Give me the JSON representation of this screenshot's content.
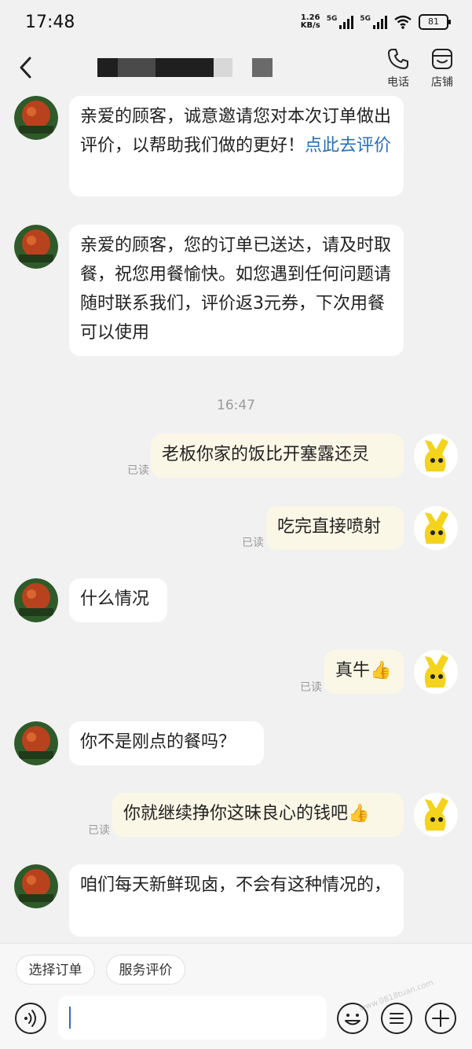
{
  "status_bar": {
    "time": "17:48",
    "net_speed": "1.26",
    "net_unit": "KB/s",
    "sim1": "5G",
    "sim2": "5G",
    "battery": "81"
  },
  "header": {
    "phone_label": "电话",
    "store_label": "店铺"
  },
  "messages": [
    {
      "from": "shop",
      "text": "亲爱的顾客，诚意邀请您对本次订单做出评价，以帮助我们做的更好！",
      "link": "点此去评价"
    },
    {
      "from": "shop",
      "text": "亲爱的顾客，您的订单已送达，请及时取餐，祝您用餐愉快。如您遇到任何问题请随时联系我们，评价返3元券，下次用餐可以使用"
    },
    {
      "timestamp": "16:47"
    },
    {
      "from": "me",
      "text": "老板你家的饭比开塞露还灵",
      "status": "已读"
    },
    {
      "from": "me",
      "text": "吃完直接喷射",
      "status": "已读"
    },
    {
      "from": "shop",
      "text": "什么情况"
    },
    {
      "from": "me",
      "text": "真牛",
      "emoji": "👍",
      "status": "已读"
    },
    {
      "from": "shop",
      "text": "你不是刚点的餐吗？"
    },
    {
      "from": "me",
      "text": "你就继续挣你这昧良心的钱吧",
      "emoji": "👍",
      "status": "已读"
    },
    {
      "from": "shop",
      "text": "咱们每天新鲜现卤，不会有这种情况的，"
    }
  ],
  "bottom": {
    "chips": [
      "选择订单",
      "服务评价"
    ],
    "input_value": "",
    "watermark": "www.0818tuan.com"
  },
  "colors": {
    "background": "#f1f1f1",
    "bubble_other": "#ffffff",
    "bubble_me": "#fbf7e6",
    "link": "#2b6fb6",
    "read_status": "#9a9a9a"
  },
  "icons": [
    "back-arrow-icon",
    "phone-icon",
    "store-icon",
    "voice-icon",
    "emoji-icon",
    "list-icon",
    "plus-icon"
  ]
}
